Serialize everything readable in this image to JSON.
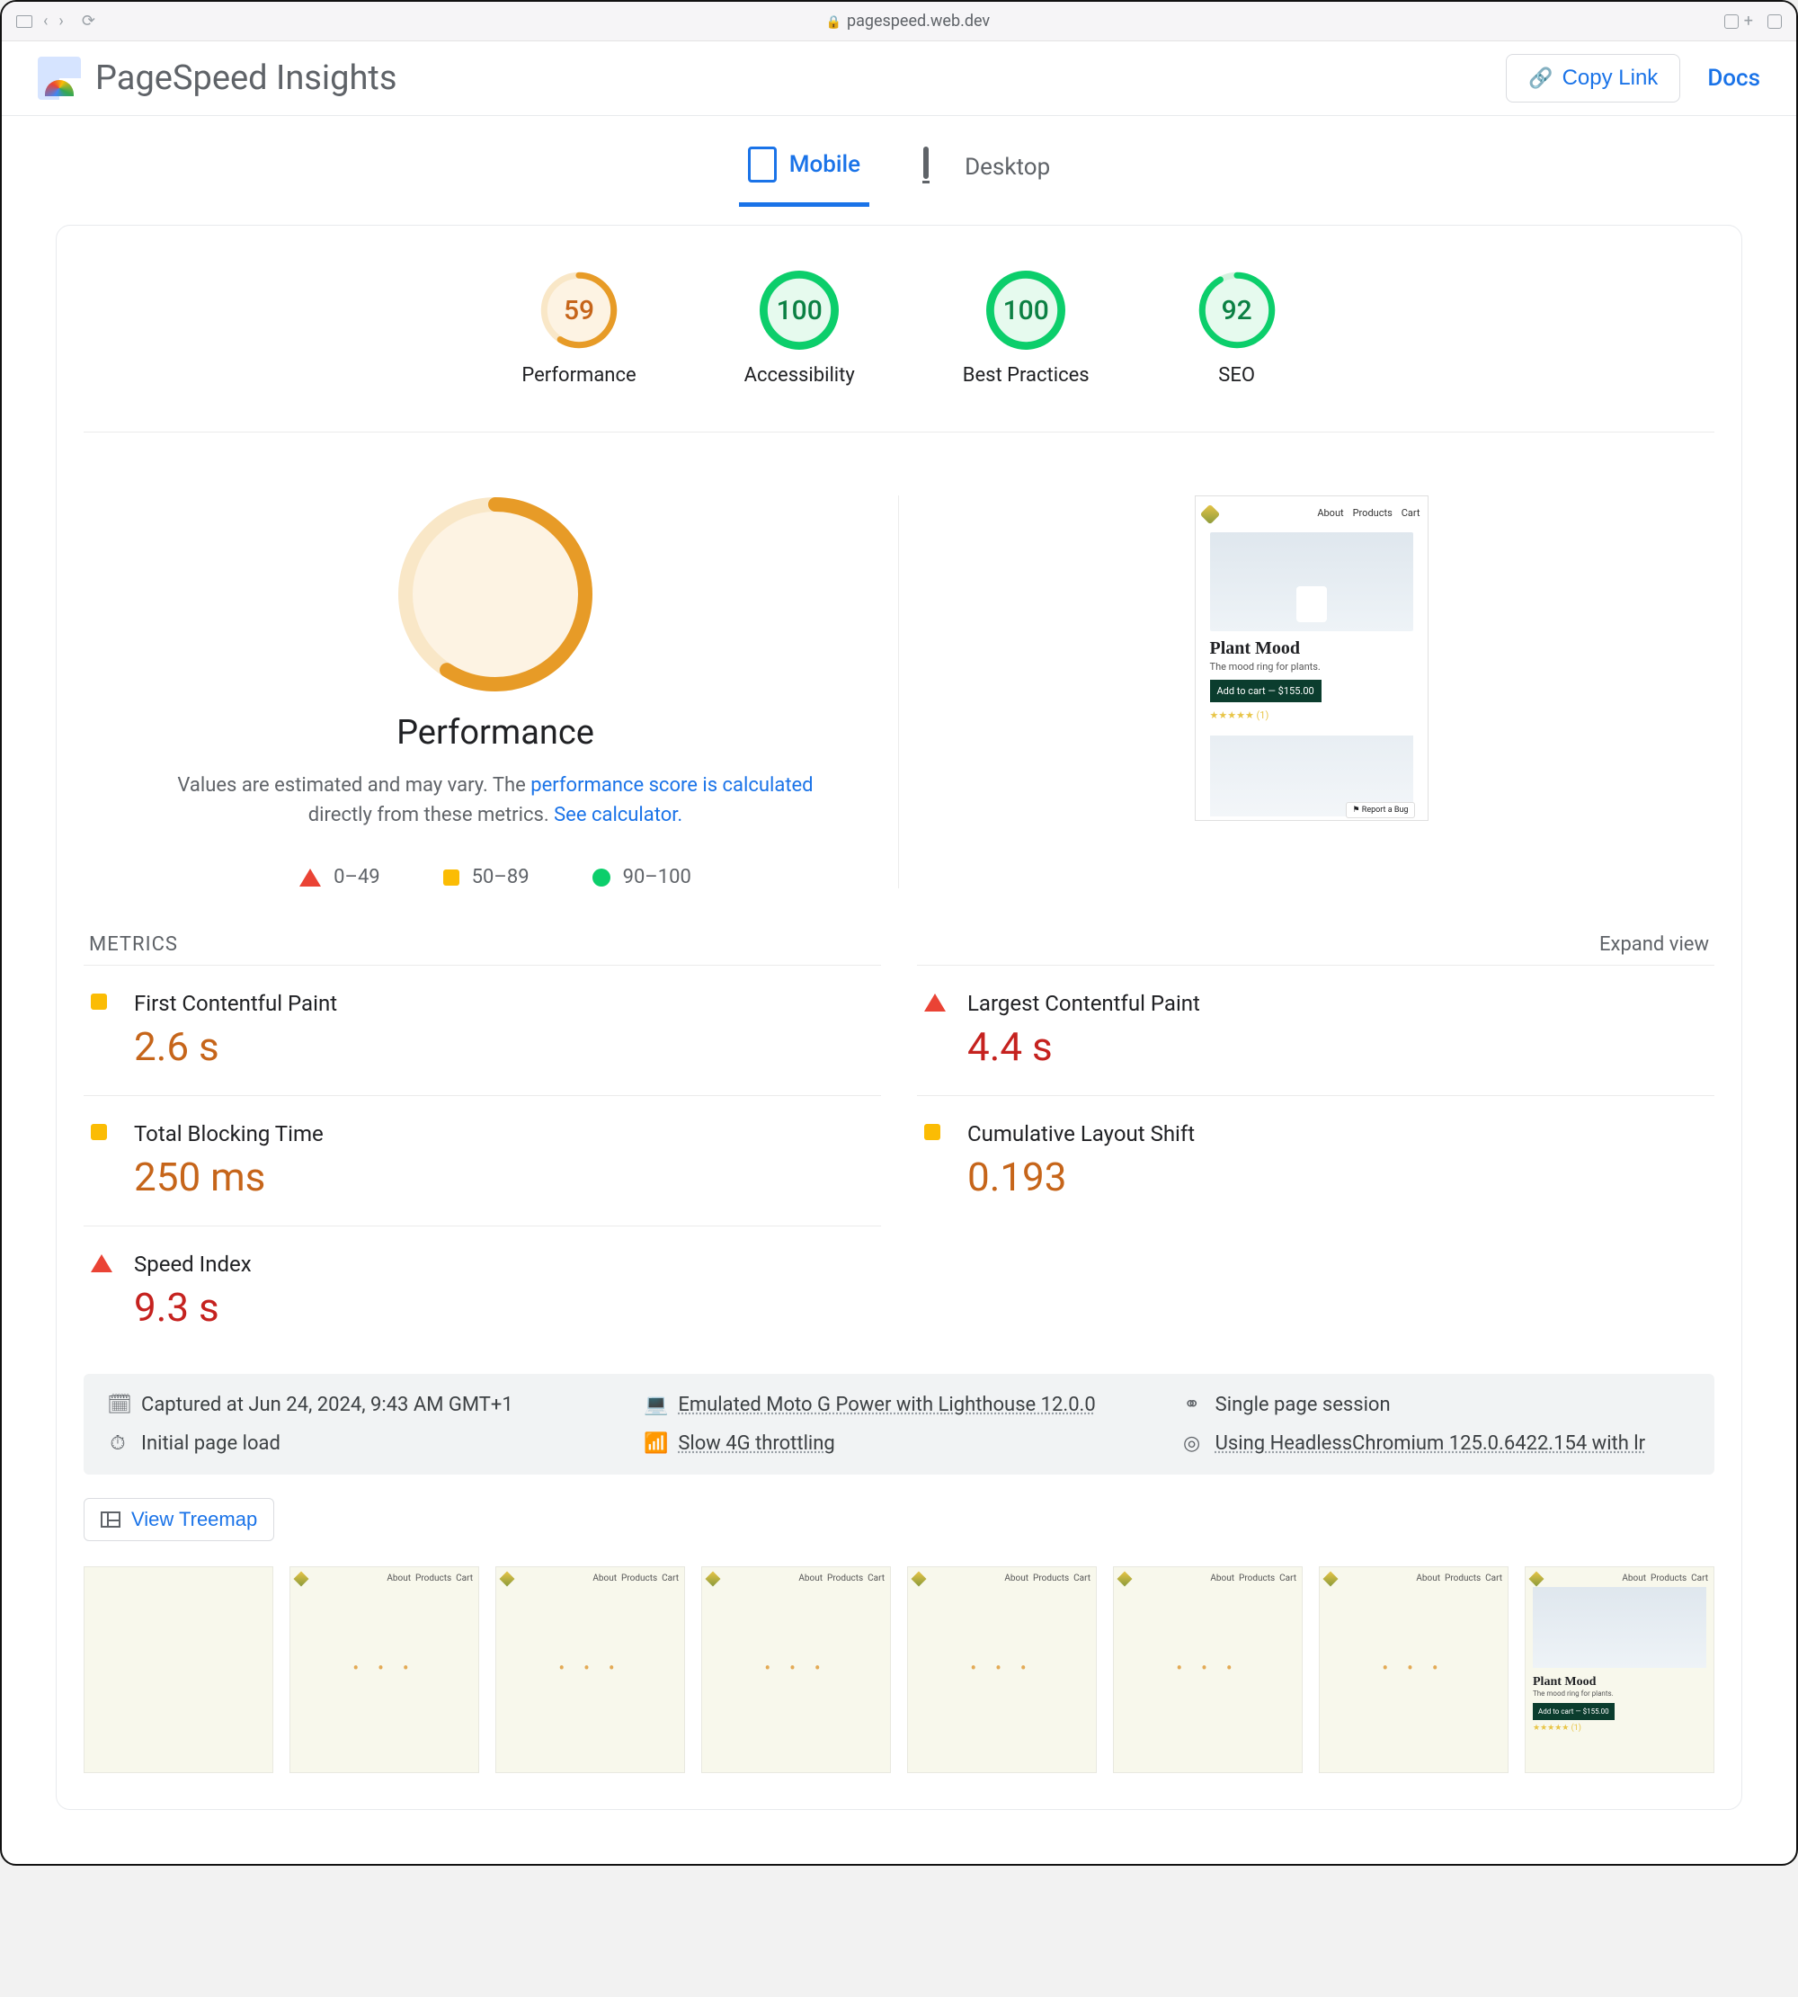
{
  "browser": {
    "url": "pagespeed.web.dev"
  },
  "header": {
    "title": "PageSpeed Insights",
    "copy_link_label": "Copy Link",
    "docs_label": "Docs"
  },
  "tabs": {
    "mobile": "Mobile",
    "desktop": "Desktop",
    "active": "mobile"
  },
  "scores": {
    "performance": {
      "label": "Performance",
      "value": 59,
      "level": "avg"
    },
    "accessibility": {
      "label": "Accessibility",
      "value": 100,
      "level": "good"
    },
    "best_practices": {
      "label": "Best Practices",
      "value": 100,
      "level": "good"
    },
    "seo": {
      "label": "SEO",
      "value": 92,
      "level": "good"
    }
  },
  "performance_block": {
    "score": 59,
    "title": "Performance",
    "note_prefix": "Values are estimated and may vary. The ",
    "note_link1": "performance score is calculated",
    "note_mid": " directly from these metrics. ",
    "note_link2": "See calculator.",
    "legend": {
      "bad": "0–49",
      "avg": "50–89",
      "good": "90–100"
    }
  },
  "mock_page": {
    "nav": {
      "about": "About",
      "products": "Products",
      "cart": "Cart"
    },
    "name": "Plant Mood",
    "tagline": "The mood ring for plants.",
    "cta": "Add to cart — $155.00",
    "rating": "★★★★★ (1)",
    "badge": "⚑ Report a Bug"
  },
  "metrics_section": {
    "heading": "METRICS",
    "expand": "Expand view",
    "items": [
      {
        "name": "First Contentful Paint",
        "value": "2.6 s",
        "level": "avg"
      },
      {
        "name": "Largest Contentful Paint",
        "value": "4.4 s",
        "level": "bad"
      },
      {
        "name": "Total Blocking Time",
        "value": "250 ms",
        "level": "avg"
      },
      {
        "name": "Cumulative Layout Shift",
        "value": "0.193",
        "level": "avg"
      },
      {
        "name": "Speed Index",
        "value": "9.3 s",
        "level": "bad"
      }
    ]
  },
  "capture": {
    "captured_at": "Captured at Jun 24, 2024, 9:43 AM GMT+1",
    "emulated": "Emulated Moto G Power with Lighthouse 12.0.0",
    "session": "Single page session",
    "load": "Initial page load",
    "throttle": "Slow 4G throttling",
    "ua": "Using HeadlessChromium 125.0.6422.154 with lr"
  },
  "treemap_label": "View Treemap",
  "filmstrip": {
    "frames": [
      {
        "state": "blank"
      },
      {
        "state": "loading"
      },
      {
        "state": "loading"
      },
      {
        "state": "loading"
      },
      {
        "state": "loading"
      },
      {
        "state": "loading"
      },
      {
        "state": "loading"
      },
      {
        "state": "loaded"
      }
    ]
  }
}
